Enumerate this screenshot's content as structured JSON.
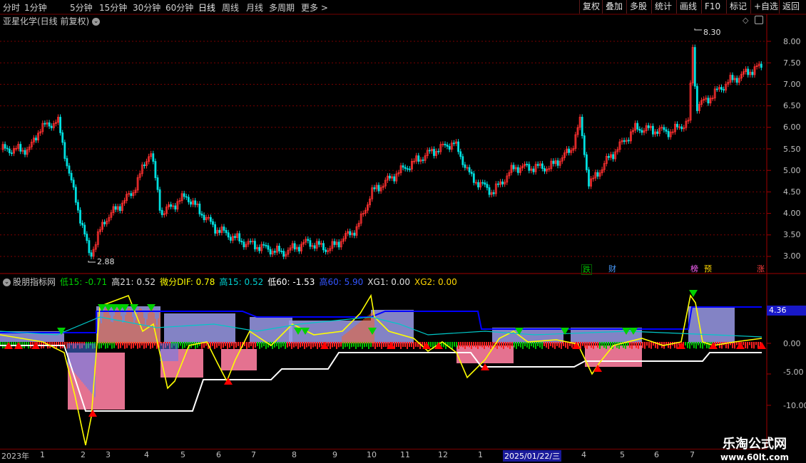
{
  "toolbar": {
    "periods": [
      "分时",
      "1分钟",
      "5分钟",
      "15分钟",
      "30分钟",
      "60分钟",
      "日线",
      "周线",
      "月线",
      "多周期",
      "更多"
    ],
    "active_period": "日线",
    "buttons": [
      "复权",
      "叠加",
      "多股",
      "统计",
      "画线",
      "F10",
      "标记",
      "+自选",
      "返回"
    ]
  },
  "main_pane": {
    "title": "亚星化学(日线 前复权)",
    "price_axis": [
      "8.00",
      "7.50",
      "7.00",
      "6.50",
      "6.00",
      "5.50",
      "5.00",
      "4.50",
      "4.00",
      "3.50",
      "3.00"
    ],
    "high_marker": "8.30",
    "low_marker": "2.88",
    "events": [
      {
        "text": "跌",
        "color": "#00c000"
      },
      {
        "text": "财",
        "color": "#4a9cff"
      },
      {
        "text": "榜",
        "color": "#ff66ff"
      },
      {
        "text": "预",
        "color": "#ffd700"
      },
      {
        "text": "涨",
        "color": "#ff4040"
      }
    ]
  },
  "indicator_pane": {
    "name": "股朋指标网",
    "fields": [
      {
        "text": "低15: -0.71",
        "color": "#00d000"
      },
      {
        "text": "高21: 0.52",
        "color": "#e0e0e0"
      },
      {
        "text": "微分DIF: 0.78",
        "color": "#ffff00"
      },
      {
        "text": "高15: 0.52",
        "color": "#00d0d0"
      },
      {
        "text": "低60: -1.53",
        "color": "#ffffff"
      },
      {
        "text": "高60: 5.90",
        "color": "#3355ff"
      },
      {
        "text": "XG1: 0.00",
        "color": "#e0e0e0"
      },
      {
        "text": "XG2: 0.00",
        "color": "#ffd700"
      }
    ],
    "axis": [
      "0.00",
      "-5.00",
      "-10.00"
    ],
    "current_value": "4.36"
  },
  "dates": [
    "2023年",
    "1",
    "2",
    "3",
    "4",
    "5",
    "6",
    "7",
    "8",
    "9",
    "10",
    "11",
    "12",
    "1",
    "2025/01/22/三",
    "4",
    "5",
    "6",
    "7"
  ],
  "watermark": {
    "line1": "乐淘公式网",
    "line2": "www.60lt.com"
  },
  "colors": {
    "up": "#ff3030",
    "down": "#00e0e0",
    "grid": "#7a0000",
    "highline": "#0000ff"
  }
}
